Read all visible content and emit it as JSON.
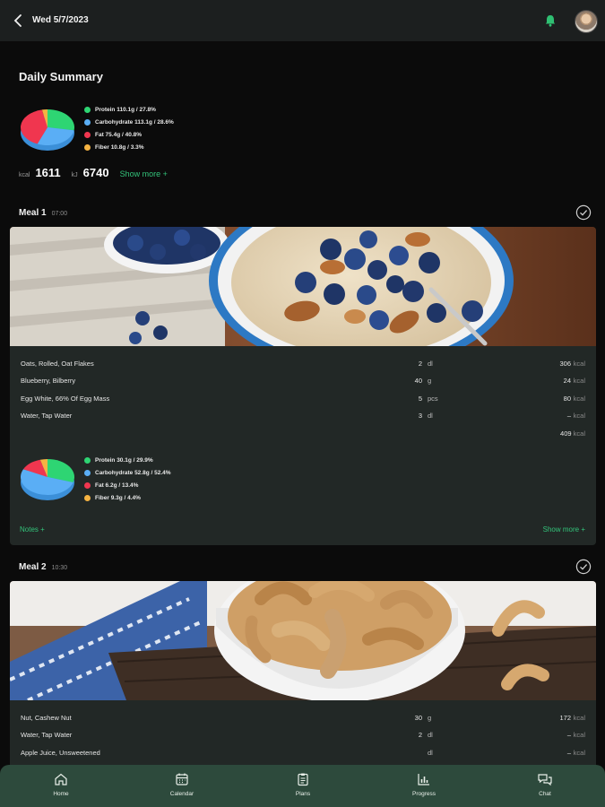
{
  "header": {
    "date": "Wed 5/7/2023"
  },
  "summary": {
    "title": "Daily Summary",
    "macros": [
      {
        "label": "Protein 110.1g / 27.8%",
        "color": "#2ed573"
      },
      {
        "label": "Carbohydrate 113.1g / 28.6%",
        "color": "#5aaef5"
      },
      {
        "label": "Fat 75.4g / 40.8%",
        "color": "#f0364f"
      },
      {
        "label": "Fiber 10.8g / 3.3%",
        "color": "#f5b342"
      }
    ],
    "pie": [
      27.8,
      28.6,
      40.8,
      3.3
    ],
    "kcal_label": "kcal",
    "kcal_value": "1611",
    "kj_label": "kJ",
    "kj_value": "6740",
    "show_more": "Show more +"
  },
  "meals": [
    {
      "title": "Meal 1",
      "time": "07:00",
      "items": [
        {
          "name": "Oats, Rolled, Oat Flakes",
          "qty": "2",
          "unit": "dl",
          "kcal": "306",
          "kcal_unit": "kcal"
        },
        {
          "name": "Blueberry, Bilberry",
          "qty": "40",
          "unit": "g",
          "kcal": "24",
          "kcal_unit": "kcal"
        },
        {
          "name": "Egg White, 66% Of Egg Mass",
          "qty": "5",
          "unit": "pcs",
          "kcal": "80",
          "kcal_unit": "kcal"
        },
        {
          "name": "Water, Tap Water",
          "qty": "3",
          "unit": "dl",
          "kcal": "–",
          "kcal_unit": "kcal"
        }
      ],
      "total": "409",
      "total_unit": "kcal",
      "macros": [
        {
          "label": "Protein 30.1g / 29.9%",
          "color": "#2ed573"
        },
        {
          "label": "Carbohydrate 52.8g / 52.4%",
          "color": "#5aaef5"
        },
        {
          "label": "Fat 6.2g / 13.4%",
          "color": "#f0364f"
        },
        {
          "label": "Fiber 9.3g / 4.4%",
          "color": "#f5b342"
        }
      ],
      "pie": [
        29.9,
        52.4,
        13.4,
        4.4
      ],
      "notes": "Notes +",
      "show_more": "Show more +"
    },
    {
      "title": "Meal 2",
      "time": "10:30",
      "items": [
        {
          "name": "Nut, Cashew Nut",
          "qty": "30",
          "unit": "g",
          "kcal": "172",
          "kcal_unit": "kcal"
        },
        {
          "name": "Water, Tap Water",
          "qty": "2",
          "unit": "dl",
          "kcal": "–",
          "kcal_unit": "kcal"
        },
        {
          "name": "Apple Juice, Unsweetened",
          "qty": "",
          "unit": "dl",
          "kcal": "–",
          "kcal_unit": "kcal"
        }
      ]
    }
  ],
  "nav": [
    {
      "label": "Home",
      "icon": "home-icon"
    },
    {
      "label": "Calendar",
      "icon": "calendar-icon"
    },
    {
      "label": "Plans",
      "icon": "clipboard-icon"
    },
    {
      "label": "Progress",
      "icon": "chart-icon"
    },
    {
      "label": "Chat",
      "icon": "chat-icon"
    }
  ]
}
